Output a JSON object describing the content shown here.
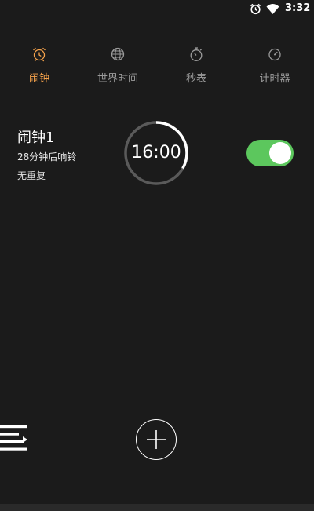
{
  "status_bar": {
    "time": "3:32",
    "icons": [
      "alarm-icon",
      "wifi-icon"
    ]
  },
  "tabs": [
    {
      "label": "闹钟",
      "icon": "alarm-clock-icon",
      "active": true
    },
    {
      "label": "世界时间",
      "icon": "globe-icon",
      "active": false
    },
    {
      "label": "秒表",
      "icon": "stopwatch-icon",
      "active": false
    },
    {
      "label": "计时器",
      "icon": "timer-icon",
      "active": false
    }
  ],
  "alarm": {
    "title": "闹钟1",
    "countdown_text": "28分钟后响铃",
    "repeat_text": "无重复",
    "time": "16:00",
    "enabled": true
  },
  "colors": {
    "background": "#1b1b1b",
    "accent": "#f5a24b",
    "toggle_on": "#5cc75d",
    "inactive_text": "#9b9b9b"
  },
  "actions": {
    "menu_icon": "menu-icon",
    "add_icon": "plus-icon"
  }
}
